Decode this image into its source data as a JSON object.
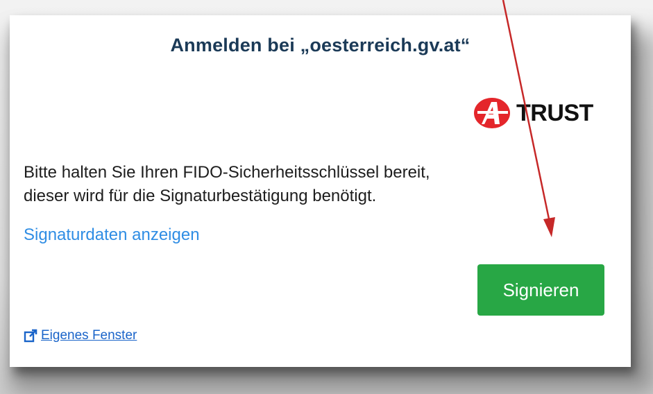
{
  "dialog": {
    "title": "Anmelden bei „oesterreich.gv.at“",
    "logo": {
      "text": "TRUST",
      "mark_letter": "A"
    },
    "message_line1": "Bitte halten Sie Ihren FIDO-Sicherheitsschlüssel bereit,",
    "message_line2": "dieser wird für die Signaturbestätigung benötigt.",
    "show_signature_data_link": "Signaturdaten anzeigen",
    "sign_button_label": "Signieren",
    "own_window_link": "Eigenes Fenster"
  },
  "colors": {
    "title": "#1b3a57",
    "link": "#2f8de4",
    "sign_button": "#28a745",
    "annotation_arrow": "#c62828",
    "logo_mark": "#e4262b"
  },
  "icons": {
    "logo_mark": "a-trust-logo-icon",
    "own_window": "external-link-icon",
    "annotation": "red-arrow"
  }
}
